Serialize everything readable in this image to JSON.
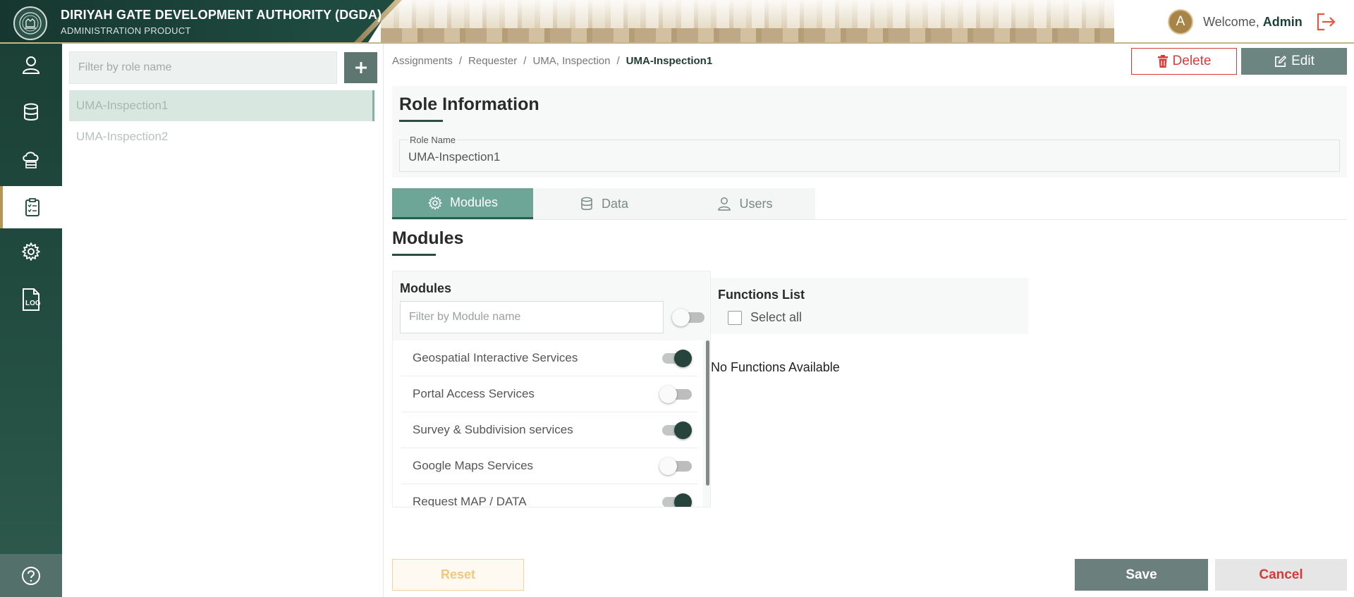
{
  "header": {
    "org_name": "DIRIYAH GATE DEVELOPMENT AUTHORITY (DGDA)",
    "product_name": "ADMINISTRATION PRODUCT",
    "avatar_initial": "A",
    "welcome_prefix": "Welcome,",
    "username": "Admin"
  },
  "nav": {
    "items": [
      {
        "icon": "user-icon"
      },
      {
        "icon": "database-icon"
      },
      {
        "icon": "cloud-server-icon"
      },
      {
        "icon": "clipboard-checklist-icon",
        "active": true
      },
      {
        "icon": "gear-icon"
      },
      {
        "icon": "log-file-icon",
        "label": "LOG"
      }
    ],
    "help_icon": "help-icon"
  },
  "roles": {
    "filter_placeholder": "Filter by role name",
    "add_icon": "plus-icon",
    "items": [
      "UMA-Inspection1",
      "UMA-Inspection2"
    ],
    "selected": "UMA-Inspection1"
  },
  "breadcrumb": {
    "items": [
      "Assignments",
      "Requester",
      "UMA, Inspection"
    ],
    "separator": "/",
    "current": "UMA-Inspection1"
  },
  "actions": {
    "delete_label": "Delete",
    "edit_label": "Edit"
  },
  "role_info": {
    "title": "Role Information",
    "role_name_label": "Role Name",
    "role_name_value": "UMA-Inspection1"
  },
  "tabs": [
    {
      "label": "Modules",
      "icon": "gear-icon",
      "active": true
    },
    {
      "label": "Data",
      "icon": "database-icon",
      "active": false
    },
    {
      "label": "Users",
      "icon": "user-icon",
      "active": false
    }
  ],
  "modules_section": {
    "heading": "Modules",
    "panel_title": "Modules",
    "filter_placeholder": "Filter by Module name",
    "master_toggle_on": false,
    "items": [
      {
        "name": "Geospatial Interactive Services",
        "enabled": true
      },
      {
        "name": "Portal Access Services",
        "enabled": false
      },
      {
        "name": "Survey & Subdivision services",
        "enabled": true
      },
      {
        "name": "Google Maps Services",
        "enabled": false
      },
      {
        "name": "Request MAP / DATA",
        "enabled": true
      }
    ]
  },
  "functions": {
    "title": "Functions List",
    "select_all_label": "Select all",
    "empty_text": "No Functions Available"
  },
  "footer": {
    "reset_label": "Reset",
    "save_label": "Save",
    "cancel_label": "Cancel"
  },
  "colors": {
    "brand_dark": "#1e4a3f",
    "accent_gold": "#b49656",
    "tab_active": "#6da697",
    "danger": "#d83b3b"
  }
}
